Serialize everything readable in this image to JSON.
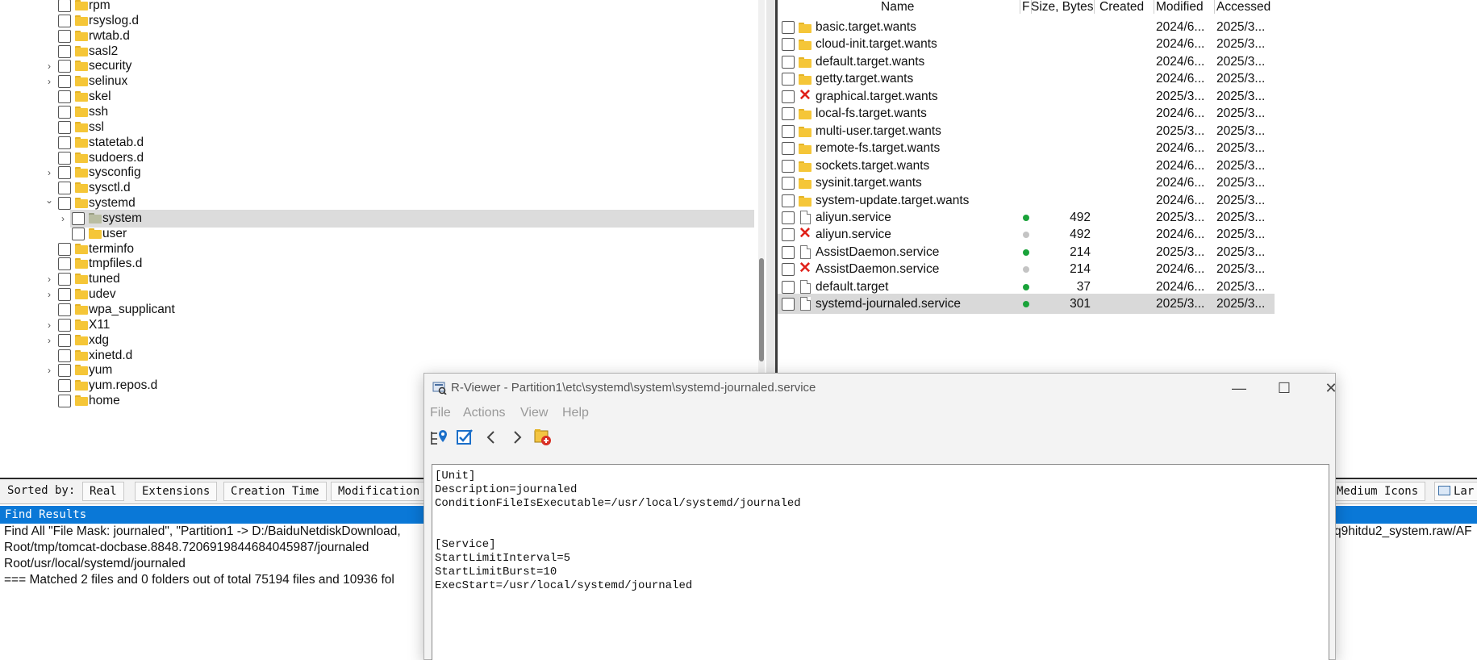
{
  "tree": {
    "items": [
      {
        "label": "rpm",
        "expander": "",
        "folder": "yellow",
        "selected": false
      },
      {
        "label": "rsyslog.d",
        "expander": "",
        "folder": "yellow",
        "selected": false
      },
      {
        "label": "rwtab.d",
        "expander": "",
        "folder": "yellow",
        "selected": false
      },
      {
        "label": "sasl2",
        "expander": "",
        "folder": "yellow",
        "selected": false
      },
      {
        "label": "security",
        "expander": "collapsed",
        "folder": "yellow",
        "selected": false
      },
      {
        "label": "selinux",
        "expander": "collapsed",
        "folder": "yellow",
        "selected": false
      },
      {
        "label": "skel",
        "expander": "",
        "folder": "yellow",
        "selected": false
      },
      {
        "label": "ssh",
        "expander": "",
        "folder": "yellow",
        "selected": false
      },
      {
        "label": "ssl",
        "expander": "",
        "folder": "yellow",
        "selected": false
      },
      {
        "label": "statetab.d",
        "expander": "",
        "folder": "yellow",
        "selected": false
      },
      {
        "label": "sudoers.d",
        "expander": "",
        "folder": "yellow",
        "selected": false
      },
      {
        "label": "sysconfig",
        "expander": "collapsed",
        "folder": "yellow",
        "selected": false
      },
      {
        "label": "sysctl.d",
        "expander": "",
        "folder": "yellow",
        "selected": false
      },
      {
        "label": "systemd",
        "expander": "expanded",
        "folder": "yellow",
        "selected": false
      },
      {
        "label": "system",
        "expander": "collapsed",
        "folder": "grey",
        "selected": true
      },
      {
        "label": "user",
        "expander": "",
        "folder": "yellow",
        "selected": false
      },
      {
        "label": "terminfo",
        "expander": "",
        "folder": "yellow",
        "selected": false
      },
      {
        "label": "tmpfiles.d",
        "expander": "",
        "folder": "yellow",
        "selected": false
      },
      {
        "label": "tuned",
        "expander": "collapsed",
        "folder": "yellow",
        "selected": false
      },
      {
        "label": "udev",
        "expander": "collapsed",
        "folder": "yellow",
        "selected": false
      },
      {
        "label": "wpa_supplicant",
        "expander": "",
        "folder": "yellow",
        "selected": false
      },
      {
        "label": "X11",
        "expander": "collapsed",
        "folder": "yellow",
        "selected": false
      },
      {
        "label": "xdg",
        "expander": "collapsed",
        "folder": "yellow",
        "selected": false
      },
      {
        "label": "xinetd.d",
        "expander": "",
        "folder": "yellow",
        "selected": false
      },
      {
        "label": "yum",
        "expander": "collapsed",
        "folder": "yellow",
        "selected": false
      },
      {
        "label": "yum.repos.d",
        "expander": "",
        "folder": "yellow",
        "selected": false
      },
      {
        "label": "home",
        "expander": "",
        "folder": "yellow",
        "selected": false
      }
    ]
  },
  "filelist": {
    "columns": [
      "Name",
      "F",
      "Size, Bytes",
      "Created",
      "Modified",
      "Accessed"
    ],
    "rows": [
      {
        "name": "basic.target.wants",
        "type": "folder",
        "status": "",
        "size": "",
        "modified": "2024/6...",
        "accessed": "2025/3...",
        "selected": false
      },
      {
        "name": "cloud-init.target.wants",
        "type": "folder",
        "status": "",
        "size": "",
        "modified": "2024/6...",
        "accessed": "2025/3...",
        "selected": false
      },
      {
        "name": "default.target.wants",
        "type": "folder",
        "status": "",
        "size": "",
        "modified": "2024/6...",
        "accessed": "2025/3...",
        "selected": false
      },
      {
        "name": "getty.target.wants",
        "type": "folder",
        "status": "",
        "size": "",
        "modified": "2024/6...",
        "accessed": "2025/3...",
        "selected": false
      },
      {
        "name": "graphical.target.wants",
        "type": "deleted",
        "status": "",
        "size": "",
        "modified": "2025/3...",
        "accessed": "2025/3...",
        "selected": false
      },
      {
        "name": "local-fs.target.wants",
        "type": "folder",
        "status": "",
        "size": "",
        "modified": "2024/6...",
        "accessed": "2025/3...",
        "selected": false
      },
      {
        "name": "multi-user.target.wants",
        "type": "folder",
        "status": "",
        "size": "",
        "modified": "2025/3...",
        "accessed": "2025/3...",
        "selected": false
      },
      {
        "name": "remote-fs.target.wants",
        "type": "folder",
        "status": "",
        "size": "",
        "modified": "2024/6...",
        "accessed": "2025/3...",
        "selected": false
      },
      {
        "name": "sockets.target.wants",
        "type": "folder",
        "status": "",
        "size": "",
        "modified": "2024/6...",
        "accessed": "2025/3...",
        "selected": false
      },
      {
        "name": "sysinit.target.wants",
        "type": "folder",
        "status": "",
        "size": "",
        "modified": "2024/6...",
        "accessed": "2025/3...",
        "selected": false
      },
      {
        "name": "system-update.target.wants",
        "type": "folder",
        "status": "",
        "size": "",
        "modified": "2024/6...",
        "accessed": "2025/3...",
        "selected": false
      },
      {
        "name": "aliyun.service",
        "type": "file",
        "status": "green",
        "size": "492",
        "modified": "2025/3...",
        "accessed": "2025/3...",
        "selected": false
      },
      {
        "name": "aliyun.service",
        "type": "deleted",
        "status": "grey",
        "size": "492",
        "modified": "2024/6...",
        "accessed": "2025/3...",
        "selected": false
      },
      {
        "name": "AssistDaemon.service",
        "type": "file",
        "status": "green",
        "size": "214",
        "modified": "2025/3...",
        "accessed": "2025/3...",
        "selected": false
      },
      {
        "name": "AssistDaemon.service",
        "type": "deleted",
        "status": "grey",
        "size": "214",
        "modified": "2024/6...",
        "accessed": "2025/3...",
        "selected": false
      },
      {
        "name": "default.target",
        "type": "file",
        "status": "green",
        "size": "37",
        "modified": "2024/6...",
        "accessed": "2025/3...",
        "selected": false
      },
      {
        "name": "systemd-journaled.service",
        "type": "file",
        "status": "green",
        "size": "301",
        "modified": "2025/3...",
        "accessed": "2025/3...",
        "selected": true
      }
    ],
    "colors": {
      "green": "#1aa33a",
      "grey": "#c4c4c4",
      "deleted": "#e0211a"
    }
  },
  "sortbar": {
    "label": "Sorted by:",
    "buttons": [
      "Real",
      "Extensions",
      "Creation Time",
      "Modification"
    ],
    "view_buttons": [
      "Medium Icons",
      "Lar"
    ]
  },
  "find": {
    "header": "Find Results",
    "lines": [
      "Find All \"File Mask: journaled\", \"Partition1 -> D:/BaiduNetdiskDownload,",
      "Root/tmp/tomcat-docbase.8848.7206919844684045987/journaled",
      "Root/usr/local/systemd/journaled",
      "=== Matched 2 files and 0 folders out of total 75194 files and 10936 fol"
    ],
    "right_fragment": "q9hitdu2_system.raw/AF"
  },
  "viewer": {
    "title": "R-Viewer - Partition1\\etc\\systemd\\system\\systemd-journaled.service",
    "menu": [
      "File",
      "Actions",
      "View",
      "Help"
    ],
    "window_buttons": {
      "minimize": "—",
      "maximize": "☐",
      "close": "✕"
    },
    "content_lines": [
      "[Unit]",
      "Description=journaled",
      "ConditionFileIsExecutable=/usr/local/systemd/journaled",
      "",
      "",
      "[Service]",
      "StartLimitInterval=5",
      "StartLimitBurst=10",
      "ExecStart=/usr/local/systemd/journaled"
    ],
    "toolbar_icons": [
      "locate-icon",
      "check-icon",
      "back-icon",
      "forward-icon",
      "recover-icon"
    ]
  }
}
